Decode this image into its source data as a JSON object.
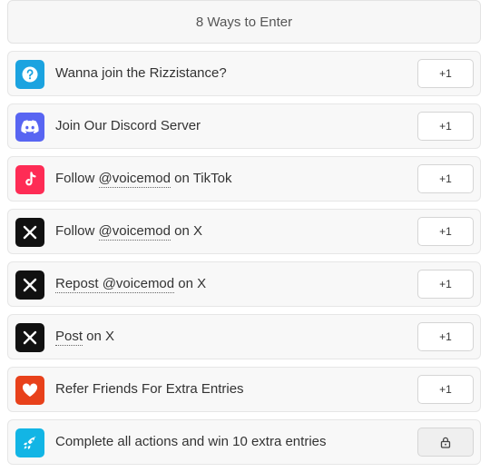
{
  "header": {
    "title": "8 Ways to Enter"
  },
  "entries": [
    {
      "parts": [
        "Wanna join the Rizzistance?"
      ],
      "button": "+1",
      "icon": "help-circle-icon",
      "color": "#1ba3e0"
    },
    {
      "parts": [
        "Join Our Discord Server"
      ],
      "button": "+1",
      "icon": "discord-icon",
      "color": "#5865f2"
    },
    {
      "parts": [
        "Follow ",
        "@voicemod",
        " on TikTok"
      ],
      "button": "+1",
      "icon": "tiktok-icon",
      "color": "#fe2c55"
    },
    {
      "parts": [
        "Follow ",
        "@voicemod",
        " on X"
      ],
      "button": "+1",
      "icon": "x-icon",
      "color": "#111111"
    },
    {
      "parts": [
        "Repost @voicemod",
        " on X"
      ],
      "button": "+1",
      "icon": "x-icon",
      "color": "#111111"
    },
    {
      "parts": [
        "Post",
        " on X"
      ],
      "button": "+1",
      "icon": "x-icon",
      "color": "#111111"
    },
    {
      "parts": [
        "Refer Friends For Extra Entries"
      ],
      "button": "+1",
      "icon": "heart-icon",
      "color": "#e8411b"
    },
    {
      "parts": [
        "Complete all actions and win 10 extra entries"
      ],
      "button": "",
      "icon": "rocket-icon",
      "color": "#12b5e5"
    }
  ],
  "locked_button": {
    "icon": "lock-icon"
  }
}
